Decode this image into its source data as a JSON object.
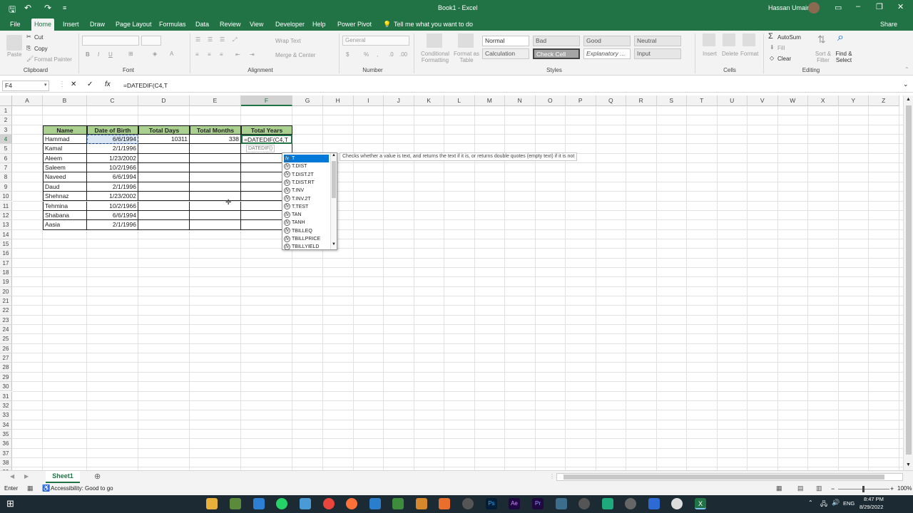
{
  "window": {
    "title": "Book1 - Excel",
    "user": "Hassan Umair"
  },
  "tabs": [
    "File",
    "Home",
    "Insert",
    "Draw",
    "Page Layout",
    "Formulas",
    "Data",
    "Review",
    "View",
    "Developer",
    "Help",
    "Power Pivot"
  ],
  "tell_me": "Tell me what you want to do",
  "share": "Share",
  "ribbon": {
    "clipboard": {
      "label": "Clipboard",
      "paste": "Paste",
      "cut": "Cut",
      "copy": "Copy",
      "format_painter": "Format Painter"
    },
    "font": {
      "label": "Font",
      "bold": "B",
      "italic": "I",
      "underline": "U"
    },
    "alignment": {
      "label": "Alignment",
      "wrap_text": "Wrap Text",
      "merge_center": "Merge & Center"
    },
    "number": {
      "label": "Number",
      "format": "General"
    },
    "styles": {
      "label": "Styles",
      "conditional": "Conditional Formatting",
      "format_table": "Format as Table",
      "items": [
        "Normal",
        "Bad",
        "Good",
        "Neutral",
        "Calculation",
        "Check Cell",
        "Explanatory ...",
        "Input"
      ]
    },
    "cells": {
      "label": "Cells",
      "insert": "Insert",
      "delete": "Delete",
      "format": "Format"
    },
    "editing": {
      "label": "Editing",
      "autosum": "AutoSum",
      "fill": "Fill",
      "clear": "Clear",
      "sort_filter": "Sort & Filter",
      "find_select": "Find & Select"
    }
  },
  "formula_bar": {
    "name_box": "F4",
    "formula": "=DATEDIF(C4,T"
  },
  "columns": [
    "A",
    "B",
    "C",
    "D",
    "E",
    "F",
    "G",
    "H",
    "I",
    "J",
    "K",
    "L",
    "M",
    "N",
    "O",
    "P",
    "Q",
    "R",
    "S",
    "T",
    "U",
    "V",
    "W",
    "X",
    "Y",
    "Z"
  ],
  "rows": [
    "1",
    "2",
    "3",
    "4",
    "5",
    "6",
    "7",
    "8",
    "9",
    "10",
    "11",
    "12",
    "13",
    "14",
    "15",
    "16",
    "17",
    "18",
    "19",
    "20",
    "21",
    "22",
    "23",
    "24",
    "25",
    "26",
    "27",
    "28",
    "29",
    "30",
    "31",
    "32",
    "33",
    "34",
    "35",
    "36",
    "37",
    "38",
    "39"
  ],
  "table": {
    "headers": [
      "Name",
      "Date of Birth",
      "Total Days",
      "Total Months",
      "Total Years"
    ],
    "rows": [
      [
        "Hammad",
        "6/6/1994",
        "10311",
        "338",
        "=DATEDIF(C4,T"
      ],
      [
        "Kamal",
        "2/1/1996",
        "",
        "",
        ""
      ],
      [
        "Aleem",
        "1/23/2002",
        "",
        "",
        ""
      ],
      [
        "Saleem",
        "10/2/1966",
        "",
        "",
        ""
      ],
      [
        "Naveed",
        "6/6/1994",
        "",
        "",
        ""
      ],
      [
        "Daud",
        "2/1/1996",
        "",
        "",
        ""
      ],
      [
        "Shehnaz",
        "1/23/2002",
        "",
        "",
        ""
      ],
      [
        "Tehmina",
        "10/2/1966",
        "",
        "",
        ""
      ],
      [
        "Shabana",
        "6/6/1994",
        "",
        "",
        ""
      ],
      [
        "Aasia",
        "2/1/1996",
        "",
        "",
        ""
      ]
    ]
  },
  "function_hint": "DATEDIF()",
  "autocomplete": [
    "T",
    "T.DIST",
    "T.DIST.2T",
    "T.DIST.RT",
    "T.INV",
    "T.INV.2T",
    "T.TEST",
    "TAN",
    "TANH",
    "TBILLEQ",
    "TBILLPRICE",
    "TBILLYIELD"
  ],
  "tooltip": "Checks whether a value is text, and returns the text if it is, or returns double quotes (empty text) if it is not",
  "sheet_tab": "Sheet1",
  "status": {
    "mode": "Enter",
    "accessibility": "Accessibility: Good to go",
    "zoom": "100%"
  },
  "taskbar": {
    "time": "8:47 PM",
    "date": "8/29/2022",
    "lang": "ENG"
  },
  "colors": {
    "accent": "#217346",
    "header_fill": "#a9d08e"
  }
}
